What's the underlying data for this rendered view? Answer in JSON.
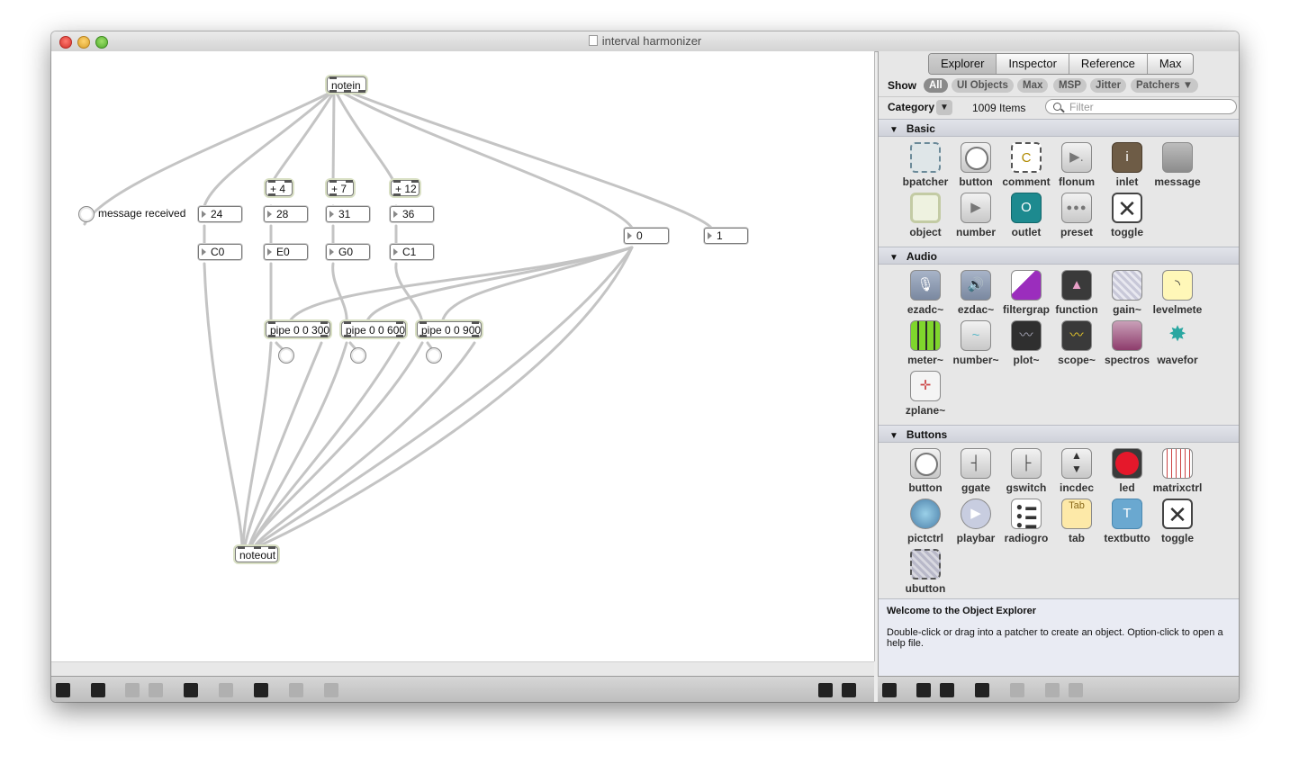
{
  "window": {
    "title": "interval harmonizer"
  },
  "patcher": {
    "objects": {
      "notein": "notein",
      "noteout": "noteout",
      "plus4": "+ 4",
      "plus7": "+ 7",
      "plus12": "+ 12",
      "pipe1": "pipe 0 0 300",
      "pipe2": "pipe 0 0 600",
      "pipe3": "pipe 0 0 900"
    },
    "numbers": {
      "n24": "24",
      "n28": "28",
      "n31": "31",
      "n36": "36"
    },
    "note_names": {
      "c0": "C0",
      "e0": "E0",
      "g0": "G0",
      "c1": "C1"
    },
    "messages": {
      "m0": "0",
      "m1": "1"
    },
    "comment": "message received"
  },
  "explorer": {
    "tabs": [
      "Explorer",
      "Inspector",
      "Reference",
      "Max"
    ],
    "active_tab": "Explorer",
    "show_label": "Show",
    "filters": [
      "All",
      "UI Objects",
      "Max",
      "MSP",
      "Jitter",
      "Patchers ▼"
    ],
    "active_filter": "All",
    "category_label": "Category",
    "category_dropdown": "▼",
    "item_count": "1009 Items",
    "filter_placeholder": "Filter",
    "sections": {
      "basic": {
        "title": "Basic",
        "items": [
          {
            "label": "bpatcher",
            "icon": "bpatcher-icon"
          },
          {
            "label": "button",
            "icon": "button-icon"
          },
          {
            "label": "comment",
            "icon": "comment-icon"
          },
          {
            "label": "flonum",
            "icon": "flonum-icon"
          },
          {
            "label": "inlet",
            "icon": "inlet-icon"
          },
          {
            "label": "message",
            "icon": "message-icon"
          },
          {
            "label": "object",
            "icon": "object-icon"
          },
          {
            "label": "number",
            "icon": "number-icon"
          },
          {
            "label": "outlet",
            "icon": "outlet-icon"
          },
          {
            "label": "preset",
            "icon": "preset-icon"
          },
          {
            "label": "toggle",
            "icon": "toggle-icon"
          }
        ]
      },
      "audio": {
        "title": "Audio",
        "items": [
          {
            "label": "ezadc~",
            "icon": "microphone-icon"
          },
          {
            "label": "ezdac~",
            "icon": "speaker-icon"
          },
          {
            "label": "filtergrap",
            "icon": "filtergraph-icon"
          },
          {
            "label": "function",
            "icon": "function-icon"
          },
          {
            "label": "gain~",
            "icon": "gain-icon"
          },
          {
            "label": "levelmete",
            "icon": "levelmeter-icon"
          },
          {
            "label": "meter~",
            "icon": "meter-icon"
          },
          {
            "label": "number~",
            "icon": "number-tilde-icon"
          },
          {
            "label": "plot~",
            "icon": "plot-icon"
          },
          {
            "label": "scope~",
            "icon": "scope-icon"
          },
          {
            "label": "spectros",
            "icon": "spectroscope-icon"
          },
          {
            "label": "wavefor",
            "icon": "waveform-icon"
          },
          {
            "label": "zplane~",
            "icon": "zplane-icon"
          }
        ]
      },
      "buttons": {
        "title": "Buttons",
        "items": [
          {
            "label": "button",
            "icon": "button-icon"
          },
          {
            "label": "ggate",
            "icon": "ggate-icon"
          },
          {
            "label": "gswitch",
            "icon": "gswitch-icon"
          },
          {
            "label": "incdec",
            "icon": "incdec-icon"
          },
          {
            "label": "led",
            "icon": "led-icon"
          },
          {
            "label": "matrixctrl",
            "icon": "matrixctrl-icon"
          },
          {
            "label": "pictctrl",
            "icon": "pictctrl-icon"
          },
          {
            "label": "playbar",
            "icon": "play-icon"
          },
          {
            "label": "radiogro",
            "icon": "radiogroup-icon"
          },
          {
            "label": "tab",
            "icon": "tab-icon"
          },
          {
            "label": "textbutto",
            "icon": "textbutton-icon"
          },
          {
            "label": "toggle",
            "icon": "toggle-icon"
          },
          {
            "label": "ubutton",
            "icon": "ubutton-icon"
          }
        ]
      }
    },
    "info": {
      "heading": "Welcome to the Object Explorer",
      "body": "Double-click or drag into a patcher to create an object. Option-click to open a help file."
    }
  },
  "icon_glyphs": {
    "comment": "C",
    "outlet": "O",
    "inlet": "i",
    "tab": "Tab",
    "textbutton": "T"
  }
}
